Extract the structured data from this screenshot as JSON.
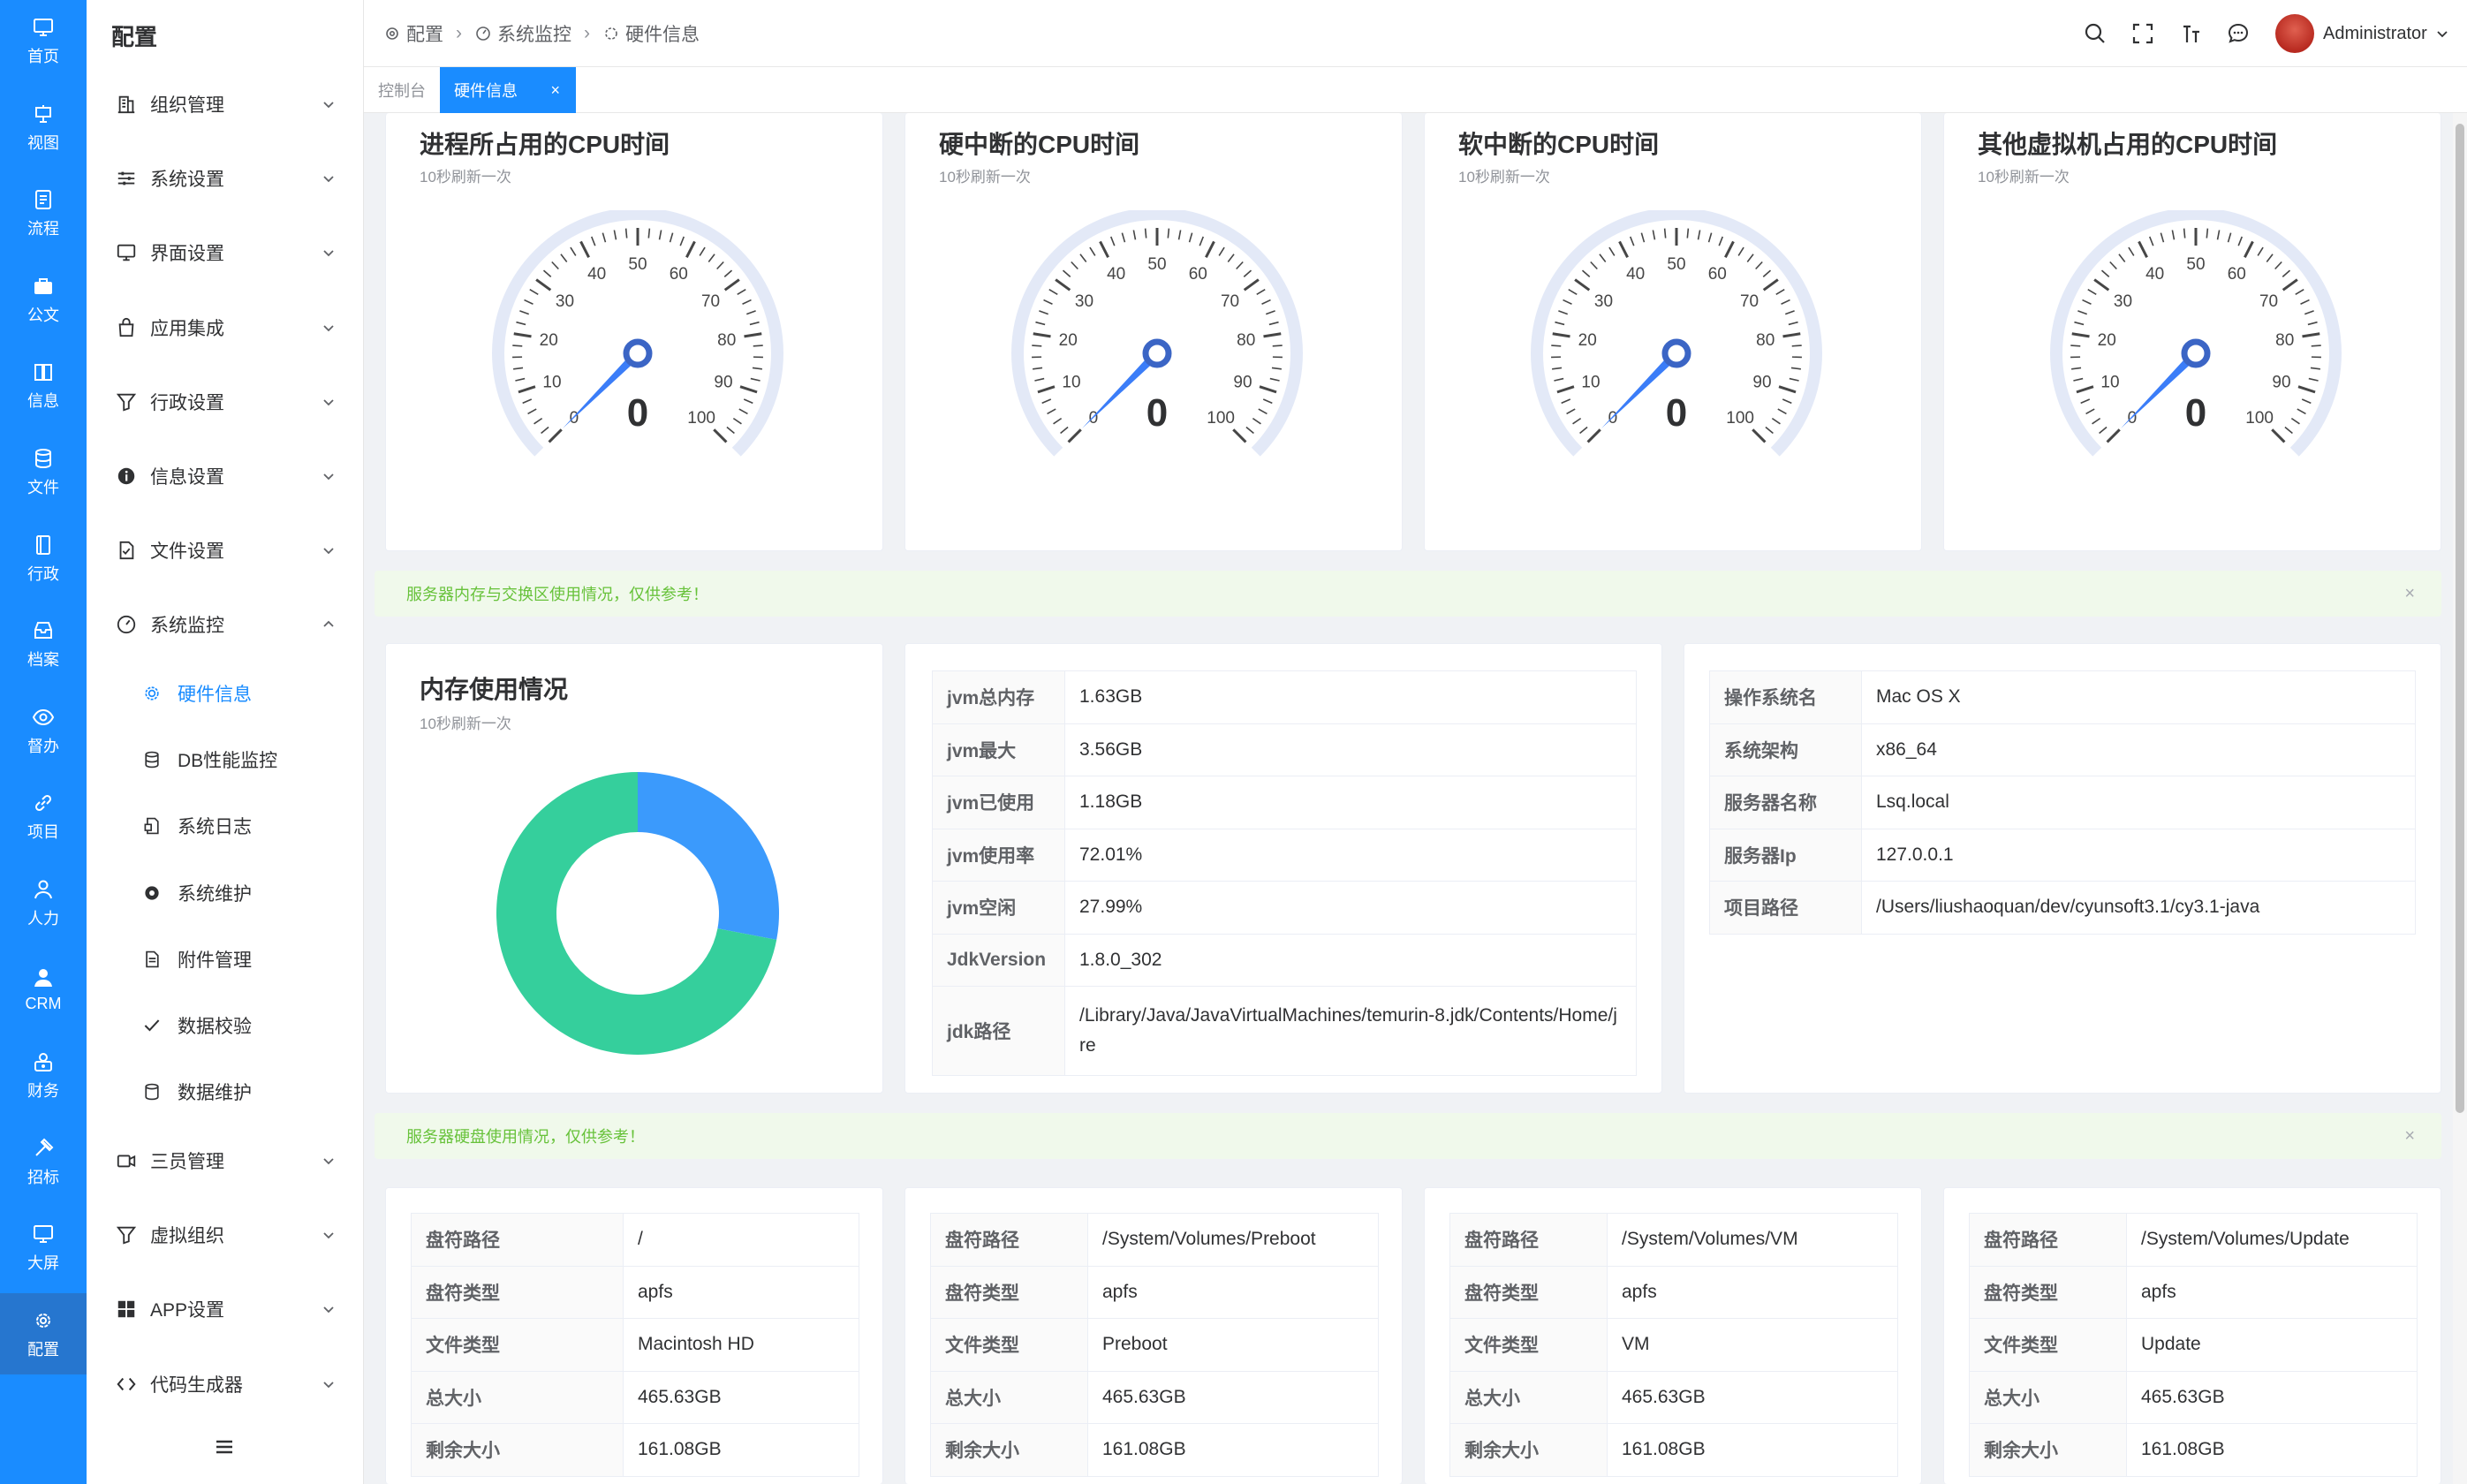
{
  "rail": [
    {
      "label": "首页",
      "icon": "monitor-icon"
    },
    {
      "label": "视图",
      "icon": "presentation-icon"
    },
    {
      "label": "流程",
      "icon": "flow-icon"
    },
    {
      "label": "公文",
      "icon": "briefcase-icon"
    },
    {
      "label": "信息",
      "icon": "book-icon"
    },
    {
      "label": "文件",
      "icon": "database-icon"
    },
    {
      "label": "行政",
      "icon": "notebook-icon"
    },
    {
      "label": "档案",
      "icon": "archive-icon"
    },
    {
      "label": "督办",
      "icon": "eye-icon"
    },
    {
      "label": "项目",
      "icon": "link-icon"
    },
    {
      "label": "人力",
      "icon": "person-icon"
    },
    {
      "label": "CRM",
      "icon": "user-icon"
    },
    {
      "label": "财务",
      "icon": "money-icon"
    },
    {
      "label": "招标",
      "icon": "hammer-icon"
    },
    {
      "label": "大屏",
      "icon": "screen-icon"
    },
    {
      "label": "配置",
      "icon": "gear-icon"
    }
  ],
  "side": {
    "title": "配置",
    "menu": [
      {
        "label": "组织管理",
        "icon": "building-icon"
      },
      {
        "label": "系统设置",
        "icon": "sliders-icon"
      },
      {
        "label": "界面设置",
        "icon": "monitor-icon"
      },
      {
        "label": "应用集成",
        "icon": "bag-icon"
      },
      {
        "label": "行政设置",
        "icon": "funnel-icon"
      },
      {
        "label": "信息设置",
        "icon": "info-icon"
      },
      {
        "label": "文件设置",
        "icon": "checkfile-icon"
      },
      {
        "label": "系统监控",
        "icon": "gauge-icon"
      }
    ],
    "sub": [
      {
        "label": "硬件信息",
        "icon": "cpu-icon"
      },
      {
        "label": "DB性能监控",
        "icon": "database-icon"
      },
      {
        "label": "系统日志",
        "icon": "log-icon"
      },
      {
        "label": "系统维护",
        "icon": "cog-icon"
      },
      {
        "label": "附件管理",
        "icon": "file-icon"
      },
      {
        "label": "数据校验",
        "icon": "check-icon"
      },
      {
        "label": "数据维护",
        "icon": "db-icon"
      }
    ],
    "menu2": [
      {
        "label": "三员管理",
        "icon": "camera-icon"
      },
      {
        "label": "虚拟组织",
        "icon": "funnel-icon"
      },
      {
        "label": "APP设置",
        "icon": "grid-icon"
      },
      {
        "label": "代码生成器",
        "icon": "code-icon"
      }
    ]
  },
  "header": {
    "crumbs": [
      "配置",
      "系统监控",
      "硬件信息"
    ],
    "user": "Administrator"
  },
  "tabs": {
    "home": "控制台",
    "active": "硬件信息",
    "close": "×"
  },
  "gauges": [
    {
      "title": "进程所占用的CPU时间",
      "sub": "10秒刷新一次",
      "value": "0"
    },
    {
      "title": "硬中断的CPU时间",
      "sub": "10秒刷新一次",
      "value": "0"
    },
    {
      "title": "软中断的CPU时间",
      "sub": "10秒刷新一次",
      "value": "0"
    },
    {
      "title": "其他虚拟机占用的CPU时间",
      "sub": "10秒刷新一次",
      "value": "0"
    }
  ],
  "gauge_ticks": [
    "0",
    "10",
    "20",
    "30",
    "40",
    "50",
    "60",
    "70",
    "80",
    "90",
    "100"
  ],
  "alerts": {
    "memory": "服务器内存与交换区使用情况，仅供参考！",
    "disk": "服务器硬盘使用情况，仅供参考！",
    "close": "×"
  },
  "memory_card": {
    "title": "内存使用情况",
    "sub": "10秒刷新一次",
    "chart_data": {
      "type": "pie",
      "slices": [
        {
          "value": 72.01,
          "color": "#35cf9c"
        },
        {
          "value": 27.99,
          "color": "#3b9afc"
        }
      ]
    }
  },
  "jvm": [
    {
      "k": "jvm总内存",
      "v": "1.63GB"
    },
    {
      "k": "jvm最大",
      "v": "3.56GB"
    },
    {
      "k": "jvm已使用",
      "v": "1.18GB"
    },
    {
      "k": "jvm使用率",
      "v": "72.01%"
    },
    {
      "k": "jvm空闲",
      "v": "27.99%"
    },
    {
      "k": "JdkVersion",
      "v": "1.8.0_302"
    },
    {
      "k": "jdk路径",
      "v": "/Library/Java/JavaVirtualMachines/temurin-8.jdk/Contents/Home/jre"
    }
  ],
  "system": [
    {
      "k": "操作系统名",
      "v": "Mac OS X"
    },
    {
      "k": "系统架构",
      "v": "x86_64"
    },
    {
      "k": "服务器名称",
      "v": "Lsq.local"
    },
    {
      "k": "服务器Ip",
      "v": "127.0.0.1"
    },
    {
      "k": "项目路径",
      "v": "/Users/liushaoquan/dev/cyunsoft3.1/cy3.1-java"
    }
  ],
  "disks": [
    {
      "rows": [
        {
          "k": "盘符路径",
          "v": "/"
        },
        {
          "k": "盘符类型",
          "v": "apfs"
        },
        {
          "k": "文件类型",
          "v": "Macintosh HD"
        },
        {
          "k": "总大小",
          "v": "465.63GB"
        },
        {
          "k": "剩余大小",
          "v": "161.08GB"
        }
      ]
    },
    {
      "rows": [
        {
          "k": "盘符路径",
          "v": "/System/Volumes/Preboot"
        },
        {
          "k": "盘符类型",
          "v": "apfs"
        },
        {
          "k": "文件类型",
          "v": "Preboot"
        },
        {
          "k": "总大小",
          "v": "465.63GB"
        },
        {
          "k": "剩余大小",
          "v": "161.08GB"
        }
      ]
    },
    {
      "rows": [
        {
          "k": "盘符路径",
          "v": "/System/Volumes/VM"
        },
        {
          "k": "盘符类型",
          "v": "apfs"
        },
        {
          "k": "文件类型",
          "v": "VM"
        },
        {
          "k": "总大小",
          "v": "465.63GB"
        },
        {
          "k": "剩余大小",
          "v": "161.08GB"
        }
      ]
    },
    {
      "rows": [
        {
          "k": "盘符路径",
          "v": "/System/Volumes/Update"
        },
        {
          "k": "盘符类型",
          "v": "apfs"
        },
        {
          "k": "文件类型",
          "v": "Update"
        },
        {
          "k": "总大小",
          "v": "465.63GB"
        },
        {
          "k": "剩余大小",
          "v": "161.08GB"
        }
      ]
    }
  ]
}
